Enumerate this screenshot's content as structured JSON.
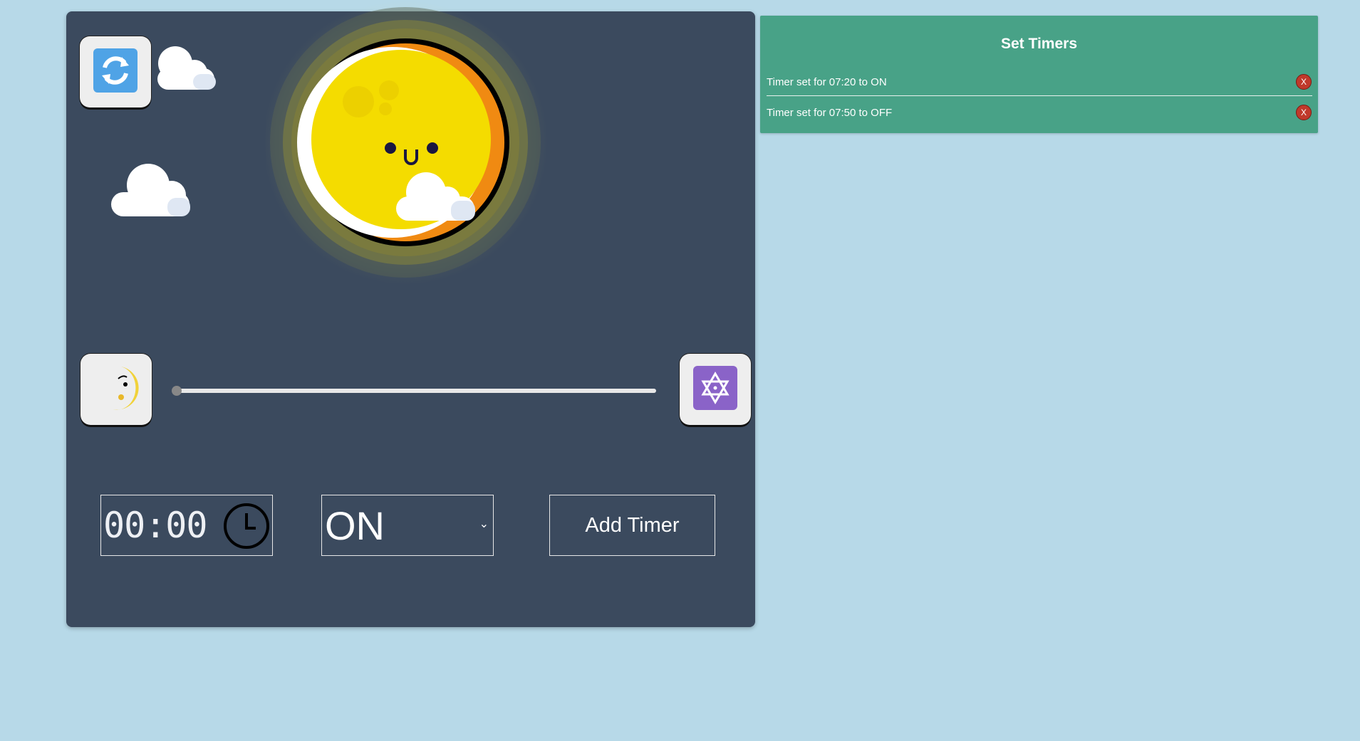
{
  "controls": {
    "time_value": "00:00",
    "mode_selected": "ON",
    "add_timer_label": "Add Timer",
    "slider_fraction": 0.0
  },
  "icons": {
    "refresh": "refresh-icon",
    "moon": "crescent-moon-icon",
    "star": "star-of-david-icon",
    "sun": "smiling-sun-icon",
    "clock": "clock-icon"
  },
  "timers_panel": {
    "title": "Set Timers",
    "items": [
      {
        "text": "Timer set for 07:20 to ON",
        "delete_label": "X"
      },
      {
        "text": "Timer set for 07:50 to OFF",
        "delete_label": "X"
      }
    ]
  },
  "colors": {
    "page_bg": "#b7d9e8",
    "panel_bg": "#3b4a5e",
    "timers_bg": "#48a287",
    "delete_red": "#c0392b",
    "refresh_blue": "#4fa3e6",
    "star_purple": "#8a63c8"
  }
}
